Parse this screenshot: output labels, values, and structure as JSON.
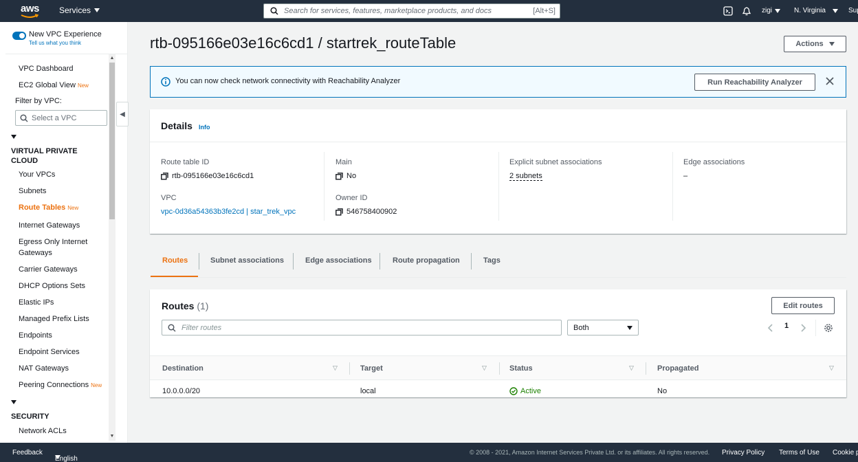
{
  "topnav": {
    "logo_text": "aws",
    "services_label": "Services",
    "search_placeholder": "Search for services, features, marketplace products, and docs",
    "search_shortcut": "[Alt+S]",
    "user": "zigi",
    "region": "N. Virginia",
    "support_partial": "Sup"
  },
  "sidebar": {
    "toggle_label": "New VPC Experience",
    "toggle_sub": "Tell us what you think",
    "dashboard": "VPC Dashboard",
    "ec2_global": "EC2 Global View",
    "new_badge": "New",
    "filter_label": "Filter by VPC:",
    "vpc_placeholder": "Select a VPC",
    "section_vpc": "VIRTUAL PRIVATE CLOUD",
    "items": [
      "Your VPCs",
      "Subnets",
      "Route Tables",
      "Internet Gateways",
      "Egress Only Internet Gateways",
      "Carrier Gateways",
      "DHCP Options Sets",
      "Elastic IPs",
      "Managed Prefix Lists",
      "Endpoints",
      "Endpoint Services",
      "NAT Gateways",
      "Peering Connections"
    ],
    "section_security": "SECURITY",
    "security_items": [
      "Network ACLs"
    ]
  },
  "main": {
    "title": "rtb-095166e03e16c6cd1 / startrek_routeTable",
    "actions_label": "Actions",
    "banner": {
      "message": "You can now check network connectivity with Reachability Analyzer",
      "button": "Run Reachability Analyzer"
    },
    "details": {
      "title": "Details",
      "info": "Info",
      "route_table_id_label": "Route table ID",
      "route_table_id": "rtb-095166e03e16c6cd1",
      "main_label": "Main",
      "main_value": "No",
      "explicit_label": "Explicit subnet associations",
      "explicit_value": "2 subnets",
      "edge_label": "Edge associations",
      "edge_value": "–",
      "vpc_label": "VPC",
      "vpc_value": "vpc-0d36a54363b3fe2cd | star_trek_vpc",
      "owner_label": "Owner ID",
      "owner_value": "546758400902"
    },
    "tabs": [
      "Routes",
      "Subnet associations",
      "Edge associations",
      "Route propagation",
      "Tags"
    ],
    "routes": {
      "title": "Routes",
      "count": "(1)",
      "edit_label": "Edit routes",
      "filter_placeholder": "Filter routes",
      "select_value": "Both",
      "page": "1",
      "columns": [
        "Destination",
        "Target",
        "Status",
        "Propagated"
      ],
      "rows": [
        {
          "destination": "10.0.0.0/20",
          "target": "local",
          "status": "Active",
          "propagated": "No"
        }
      ]
    }
  },
  "footer": {
    "feedback": "Feedback",
    "language": "English (US)",
    "copyright": "© 2008 - 2021, Amazon Internet Services Private Ltd. or its affiliates. All rights reserved.",
    "privacy": "Privacy Policy",
    "terms": "Terms of Use",
    "cookie_partial": "Cookie p"
  },
  "colors": {
    "nav_bg": "#232f3e",
    "accent_orange": "#ec7211",
    "link_blue": "#0073bb",
    "success_green": "#1d8102"
  }
}
